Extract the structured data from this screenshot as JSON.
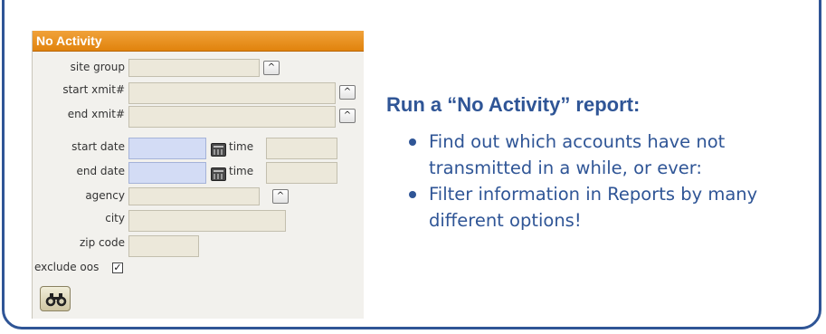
{
  "panel": {
    "title": "No Activity",
    "fields": {
      "site_group": "site group",
      "start_xmit": "start xmit#",
      "end_xmit": "end xmit#",
      "start_date": "start date",
      "end_date": "end date",
      "time_1": "time",
      "time_2": "time",
      "agency": "agency",
      "city": "city",
      "zip_code": "zip code",
      "exclude_oos": "exclude oos"
    },
    "exclude_oos_checked": true,
    "arrow_glyph": "^",
    "check_glyph": "✓",
    "colors": {
      "header": "#e68a12",
      "date_field": "#d3dcf5",
      "field": "#ece8da"
    }
  },
  "info": {
    "heading": "Run a “No Activity” report:",
    "bullets": [
      "Find out which accounts have not transmitted in a while, or ever:",
      "Filter information in Reports by many different options!"
    ],
    "color": "#2f5596"
  },
  "icons": {
    "search_button": "binoculars-icon",
    "date_picker": "calendar-icon",
    "dropdown": "chevron-up-icon"
  }
}
